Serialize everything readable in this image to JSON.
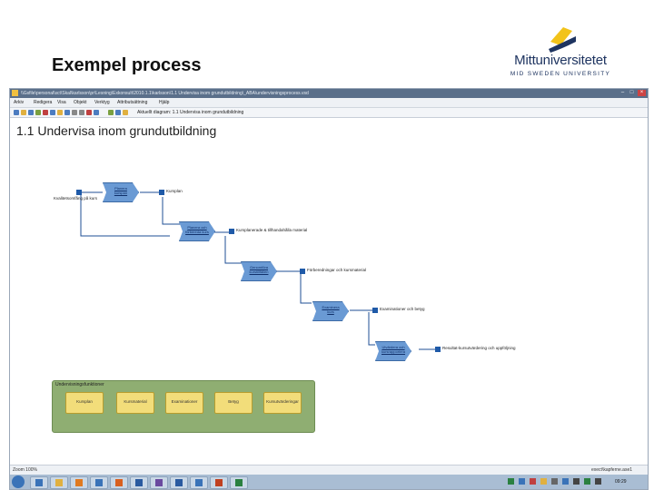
{
  "slide": {
    "title": "Exempel process",
    "logo_name": "Mittuniversitetet",
    "logo_sub": "MID SWEDEN UNIVERSITY"
  },
  "window": {
    "path": "\\\\Gsfile\\personal\\sct\\Skal\\karlsson\\pr\\Lesning\\Exkonsult\\2010.1.1\\karlsson\\1.1 Undervisa inom grundutbildning\\_ABA\\undervisningsprocess.vsd",
    "menu": [
      "Arkiv",
      "Redigera",
      "Visa",
      "Objekt",
      "Verktyg",
      "Attributsättning",
      "Hjälp"
    ],
    "breadcrumb": "Aktuellt diagram: 1.1 Undervisa inom grundutbildning",
    "diagram_title": "1.1 Undervisa inom grundutbildning",
    "status_left": "Zoom 100%",
    "status_right": "exect\\kapferne.ase1",
    "clock": "09:29"
  },
  "diagram": {
    "start_label": "Kvalitetsomfång på kurs",
    "steps": [
      {
        "label": "Planera kurspan",
        "output": "Kursplan"
      },
      {
        "label": "Planera och förbereda kurs",
        "output": "Kursplanerade & tillhandahålla material"
      },
      {
        "label": "Genomföra kurstillfällen",
        "output": "Förberedningar och kursmaterial"
      },
      {
        "label": "Examinera kurs",
        "output": "Examinationer och betyg"
      },
      {
        "label": "Utvärdera och kursrapportera",
        "output": "Resultat-kursutvärdering och uppföljning"
      }
    ]
  },
  "legend": {
    "title": "Undervisningsfunktioner",
    "items": [
      "Kursplan",
      "Kursmaterial",
      "Examinationer",
      "Betyg",
      "Kursutvärderingar"
    ]
  },
  "colors": {
    "process_fill": "#6a9ad4",
    "flow_line": "#1f4f95",
    "legend_bg": "#8fae72",
    "legend_box": "#f2dd7a",
    "logo_yellow": "#f2c31a",
    "logo_blue": "#1e3460"
  }
}
